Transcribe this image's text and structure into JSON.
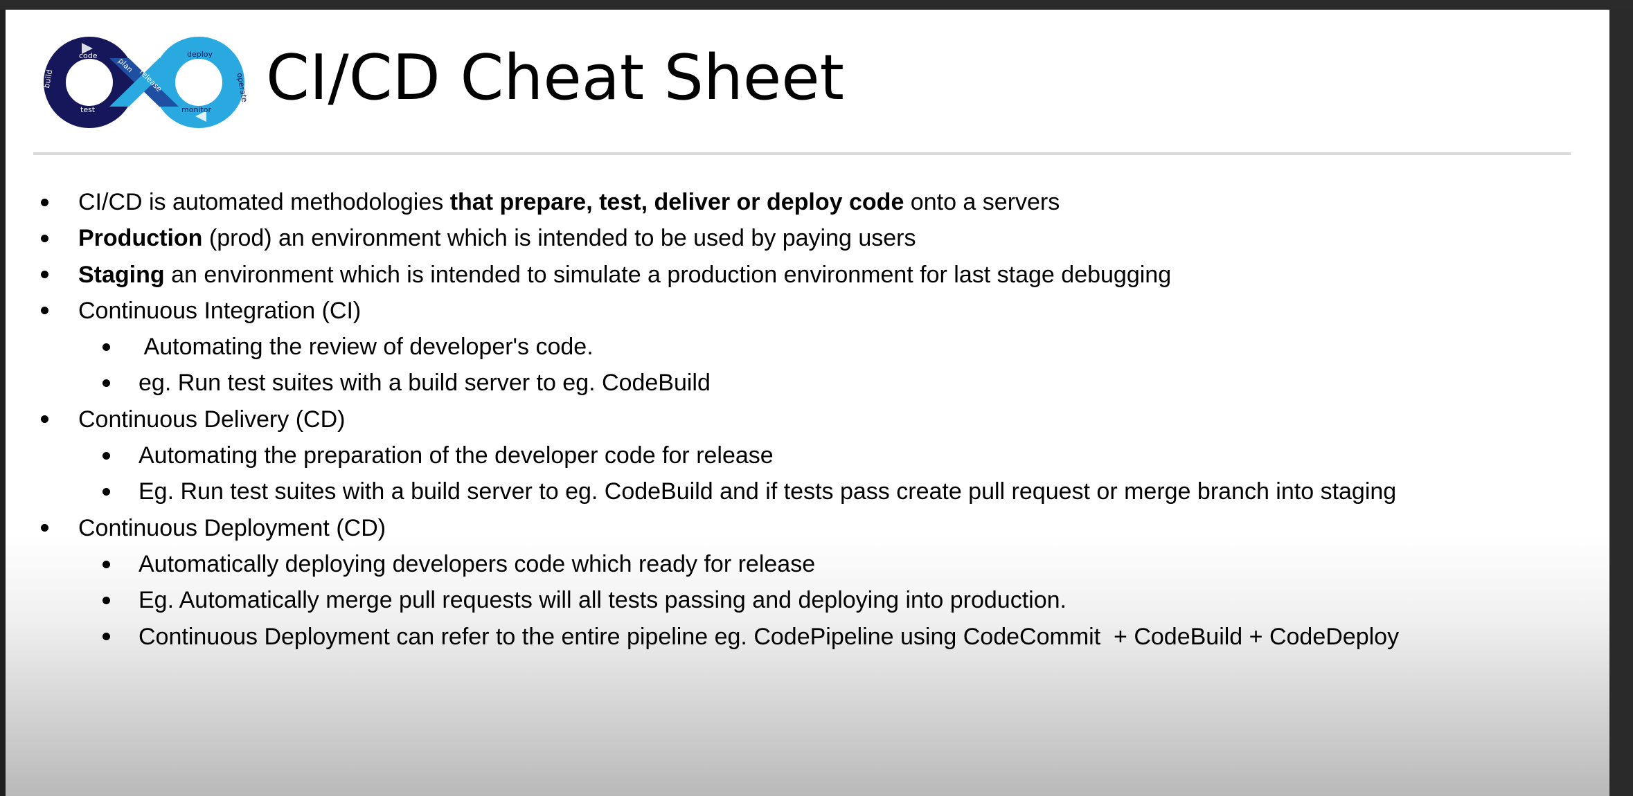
{
  "slide": {
    "title": "CI/CD Cheat Sheet",
    "logo": {
      "icon": "devops-infinity-loop-icon",
      "labels": {
        "code": "code",
        "plan": "plan",
        "build": "build",
        "test": "test",
        "release": "release",
        "deploy": "deploy",
        "operate": "operate",
        "monitor": "monitor"
      },
      "colors": {
        "dark": "#16175a",
        "mid": "#1f4fa3",
        "light": "#29a9df"
      }
    },
    "bullets": {
      "b1": {
        "a": "CI/CD is automated methodologies ",
        "b": "that prepare, test, deliver or deploy code",
        "c": " onto a servers"
      },
      "b2": {
        "b": "Production",
        "c": " (prod) an environment which is intended to be used by paying users"
      },
      "b3": {
        "b": "Staging",
        "c": " an environment which is intended to simulate a production environment for last stage debugging"
      },
      "b4": "Continuous Integration (CI)",
      "b4_1": " Automating the review of developer's code.",
      "b4_2": "eg. Run test suites with a build server to eg. CodeBuild",
      "b5": "Continuous Delivery (CD)",
      "b5_1": "Automating the preparation of the developer code for release",
      "b5_2": "Eg. Run test suites with a build server to eg. CodeBuild and if tests pass create pull request or merge branch into staging",
      "b6": "Continuous Deployment (CD)",
      "b6_1": "Automatically deploying developers code which ready for release",
      "b6_2": "Eg. Automatically merge pull requests will all tests passing and deploying into production.",
      "b6_3": "Continuous Deployment can refer to the entire pipeline eg. CodePipeline using CodeCommit  + CodeBuild + CodeDeploy"
    }
  }
}
